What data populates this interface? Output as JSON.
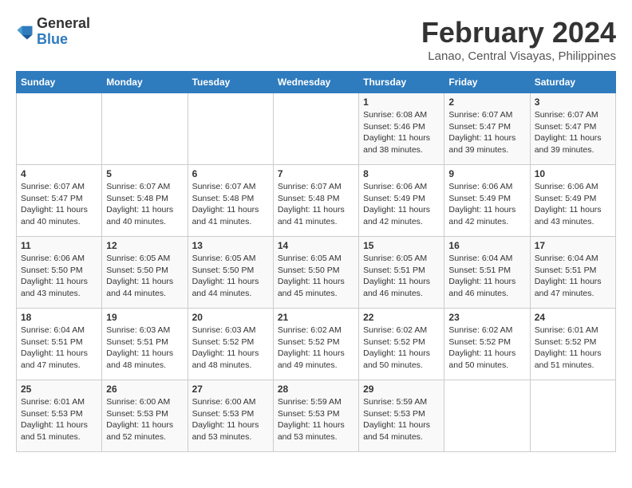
{
  "logo": {
    "general": "General",
    "blue": "Blue"
  },
  "title": "February 2024",
  "location": "Lanao, Central Visayas, Philippines",
  "days_of_week": [
    "Sunday",
    "Monday",
    "Tuesday",
    "Wednesday",
    "Thursday",
    "Friday",
    "Saturday"
  ],
  "weeks": [
    [
      {
        "day": "",
        "info": ""
      },
      {
        "day": "",
        "info": ""
      },
      {
        "day": "",
        "info": ""
      },
      {
        "day": "",
        "info": ""
      },
      {
        "day": "1",
        "info": "Sunrise: 6:08 AM\nSunset: 5:46 PM\nDaylight: 11 hours\nand 38 minutes."
      },
      {
        "day": "2",
        "info": "Sunrise: 6:07 AM\nSunset: 5:47 PM\nDaylight: 11 hours\nand 39 minutes."
      },
      {
        "day": "3",
        "info": "Sunrise: 6:07 AM\nSunset: 5:47 PM\nDaylight: 11 hours\nand 39 minutes."
      }
    ],
    [
      {
        "day": "4",
        "info": "Sunrise: 6:07 AM\nSunset: 5:47 PM\nDaylight: 11 hours\nand 40 minutes."
      },
      {
        "day": "5",
        "info": "Sunrise: 6:07 AM\nSunset: 5:48 PM\nDaylight: 11 hours\nand 40 minutes."
      },
      {
        "day": "6",
        "info": "Sunrise: 6:07 AM\nSunset: 5:48 PM\nDaylight: 11 hours\nand 41 minutes."
      },
      {
        "day": "7",
        "info": "Sunrise: 6:07 AM\nSunset: 5:48 PM\nDaylight: 11 hours\nand 41 minutes."
      },
      {
        "day": "8",
        "info": "Sunrise: 6:06 AM\nSunset: 5:49 PM\nDaylight: 11 hours\nand 42 minutes."
      },
      {
        "day": "9",
        "info": "Sunrise: 6:06 AM\nSunset: 5:49 PM\nDaylight: 11 hours\nand 42 minutes."
      },
      {
        "day": "10",
        "info": "Sunrise: 6:06 AM\nSunset: 5:49 PM\nDaylight: 11 hours\nand 43 minutes."
      }
    ],
    [
      {
        "day": "11",
        "info": "Sunrise: 6:06 AM\nSunset: 5:50 PM\nDaylight: 11 hours\nand 43 minutes."
      },
      {
        "day": "12",
        "info": "Sunrise: 6:05 AM\nSunset: 5:50 PM\nDaylight: 11 hours\nand 44 minutes."
      },
      {
        "day": "13",
        "info": "Sunrise: 6:05 AM\nSunset: 5:50 PM\nDaylight: 11 hours\nand 44 minutes."
      },
      {
        "day": "14",
        "info": "Sunrise: 6:05 AM\nSunset: 5:50 PM\nDaylight: 11 hours\nand 45 minutes."
      },
      {
        "day": "15",
        "info": "Sunrise: 6:05 AM\nSunset: 5:51 PM\nDaylight: 11 hours\nand 46 minutes."
      },
      {
        "day": "16",
        "info": "Sunrise: 6:04 AM\nSunset: 5:51 PM\nDaylight: 11 hours\nand 46 minutes."
      },
      {
        "day": "17",
        "info": "Sunrise: 6:04 AM\nSunset: 5:51 PM\nDaylight: 11 hours\nand 47 minutes."
      }
    ],
    [
      {
        "day": "18",
        "info": "Sunrise: 6:04 AM\nSunset: 5:51 PM\nDaylight: 11 hours\nand 47 minutes."
      },
      {
        "day": "19",
        "info": "Sunrise: 6:03 AM\nSunset: 5:51 PM\nDaylight: 11 hours\nand 48 minutes."
      },
      {
        "day": "20",
        "info": "Sunrise: 6:03 AM\nSunset: 5:52 PM\nDaylight: 11 hours\nand 48 minutes."
      },
      {
        "day": "21",
        "info": "Sunrise: 6:02 AM\nSunset: 5:52 PM\nDaylight: 11 hours\nand 49 minutes."
      },
      {
        "day": "22",
        "info": "Sunrise: 6:02 AM\nSunset: 5:52 PM\nDaylight: 11 hours\nand 50 minutes."
      },
      {
        "day": "23",
        "info": "Sunrise: 6:02 AM\nSunset: 5:52 PM\nDaylight: 11 hours\nand 50 minutes."
      },
      {
        "day": "24",
        "info": "Sunrise: 6:01 AM\nSunset: 5:52 PM\nDaylight: 11 hours\nand 51 minutes."
      }
    ],
    [
      {
        "day": "25",
        "info": "Sunrise: 6:01 AM\nSunset: 5:53 PM\nDaylight: 11 hours\nand 51 minutes."
      },
      {
        "day": "26",
        "info": "Sunrise: 6:00 AM\nSunset: 5:53 PM\nDaylight: 11 hours\nand 52 minutes."
      },
      {
        "day": "27",
        "info": "Sunrise: 6:00 AM\nSunset: 5:53 PM\nDaylight: 11 hours\nand 53 minutes."
      },
      {
        "day": "28",
        "info": "Sunrise: 5:59 AM\nSunset: 5:53 PM\nDaylight: 11 hours\nand 53 minutes."
      },
      {
        "day": "29",
        "info": "Sunrise: 5:59 AM\nSunset: 5:53 PM\nDaylight: 11 hours\nand 54 minutes."
      },
      {
        "day": "",
        "info": ""
      },
      {
        "day": "",
        "info": ""
      }
    ]
  ]
}
